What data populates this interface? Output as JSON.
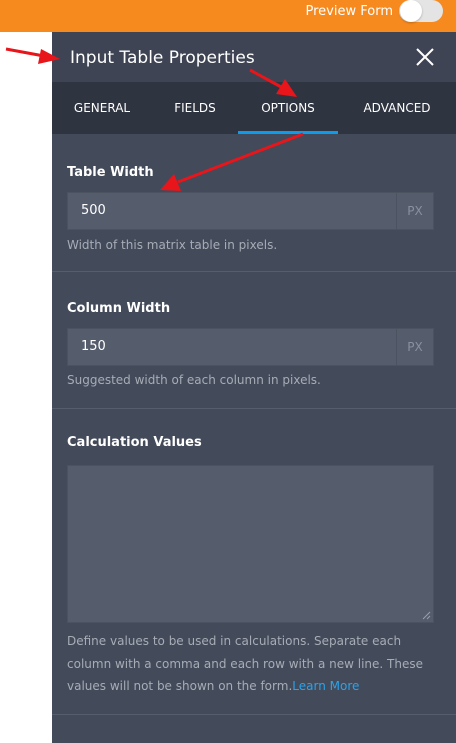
{
  "topbar": {
    "preview_label": "Preview Form",
    "toggle_state": "off"
  },
  "panel": {
    "title": "Input Table Properties",
    "close_icon": "close-icon"
  },
  "tabs": [
    {
      "label": "GENERAL",
      "active": false
    },
    {
      "label": "FIELDS",
      "active": false
    },
    {
      "label": "OPTIONS",
      "active": true
    },
    {
      "label": "ADVANCED",
      "active": false
    }
  ],
  "table_width": {
    "label": "Table Width",
    "value": "500",
    "unit": "PX",
    "help": "Width of this matrix table in pixels."
  },
  "column_width": {
    "label": "Column Width",
    "value": "150",
    "unit": "PX",
    "help": "Suggested width of each column in pixels."
  },
  "calculation_values": {
    "label": "Calculation Values",
    "value": "",
    "help": "Define values to be used in calculations. Separate each column with a comma and each row with a new line. These values will not be shown on the form.",
    "link_text": "Learn More"
  },
  "colors": {
    "topbar": "#f68a1e",
    "panel": "#434a5a",
    "tabs": "#2f3441",
    "active_tab": "#0d9bea",
    "link": "#2ba3ea",
    "annotation_arrow": "#e8151b"
  }
}
